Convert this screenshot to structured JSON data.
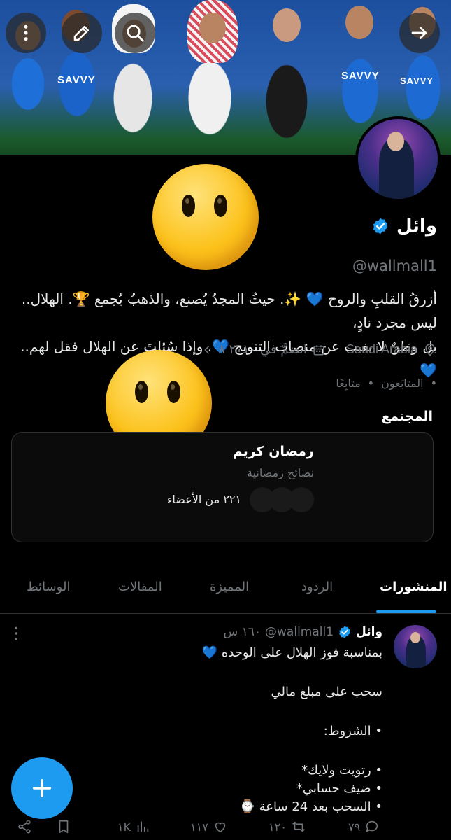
{
  "profile": {
    "name": "وائل",
    "handle": "@wallmall1",
    "bio_line1": "أزرقُ القلبِ والروح 💙 ✨. حيثُ المجدُ يُصنع، والذهبُ يُجمع 🏆. الهلال.. ليس مجرد نادٍ،",
    "bio_line2": "بل وطنٌ لا يغيب عن منصات التتويج 💙. وإذا سُئلتَ عن الهلال فقل لهم.. 💙",
    "location": "Saudi Arabia",
    "joined": "انضمَّ في ٢٠١٠‏ ٨",
    "followers_label": "المتابَعون",
    "following_label": "متابِعًا",
    "bullet": "•"
  },
  "banner": {
    "jersey_text": "SAVVY",
    "icons": [
      "arrow-right-icon",
      "search-icon",
      "edit-icon",
      "more-vertical-icon"
    ]
  },
  "community": {
    "section_title": "المجتمع",
    "name": "رمضان كريم",
    "subtitle": "نصائح رمضانية",
    "members": "٢٢١ من الأعضاء"
  },
  "tabs": [
    {
      "label": "المنشورات",
      "active": true
    },
    {
      "label": "الردود",
      "active": false
    },
    {
      "label": "المميزة",
      "active": false
    },
    {
      "label": "المقالات",
      "active": false
    },
    {
      "label": "الوسائط",
      "active": false
    }
  ],
  "tweet": {
    "name": "وائل",
    "handle": "@wallmall1",
    "time": "١٦٠ س",
    "line1": "بمناسبة فوز الهلال على الوحده 💙",
    "line2": "سحب على مبلغ مالي",
    "line3": "• الشروط:",
    "line4": "• رتويت ولايك*",
    "line5": "• ضيف حسابي*",
    "line6": "• السحب بعد 24 ساعة ⌚",
    "replies": "٧٩",
    "retweets": "١٢٠",
    "likes": "١١٧",
    "views": "١K"
  },
  "colors": {
    "accent": "#1d9bf0",
    "verified": "#1d9bf0",
    "background": "#000000",
    "muted_text": "#71767b"
  }
}
